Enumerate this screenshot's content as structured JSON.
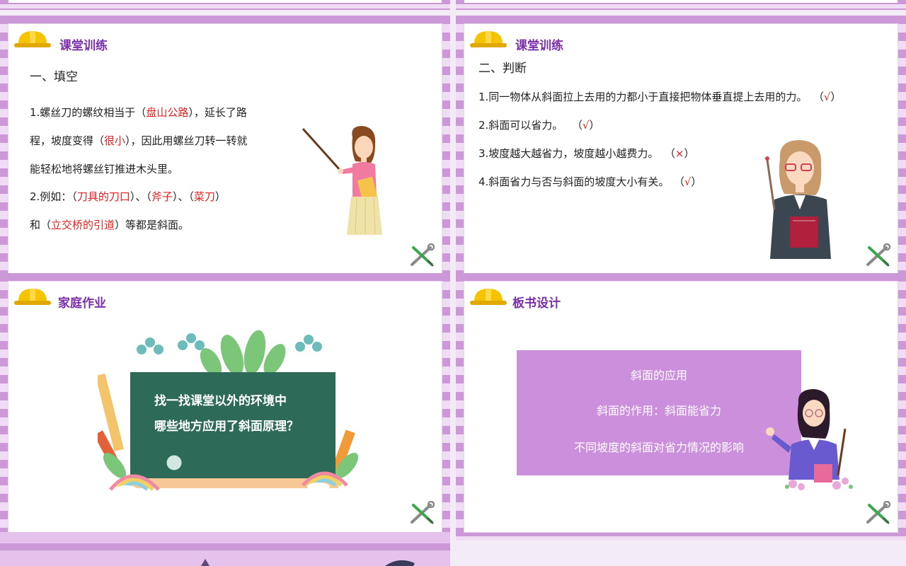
{
  "slides": {
    "s1": {
      "title": "课堂训练",
      "heading": "一、填空",
      "l1a": "1.螺丝刀的螺纹相当于（",
      "l1r": "盘山公路",
      "l1b": "），延长了路",
      "l2a": "程，坡度变得（",
      "l2r": "很小",
      "l2b": "），因此用螺丝刀转一转就",
      "l3": "能轻松地将螺丝钉推进木头里。",
      "l4a": "2.例如：（",
      "l4r1": "刀具的刀口",
      "l4b": "）、（",
      "l4r2": "斧子",
      "l4c": "）、（",
      "l4r3": "菜刀",
      "l4d": "）",
      "l5a": "和（",
      "l5r": "立交桥的引道",
      "l5b": "）等都是斜面。"
    },
    "s2": {
      "title": "课堂训练",
      "heading": "二、判断",
      "items": [
        {
          "text": "1.同一物体从斜面拉上去用的力都小于直接把物体垂直提上去用的力。",
          "open": "（",
          "mark": "√",
          "close": "）"
        },
        {
          "text": "2.斜面可以省力。",
          "open": "（",
          "mark": "√",
          "close": "）"
        },
        {
          "text": "3.坡度越大越省力，坡度越小越费力。",
          "open": "（",
          "mark": "×",
          "close": "）"
        },
        {
          "text": "4.斜面省力与否与斜面的坡度大小有关。",
          "open": "（",
          "mark": "√",
          "close": "）"
        }
      ]
    },
    "s3": {
      "title": "家庭作业",
      "board_line1": "找一找课堂以外的环境中",
      "board_line2": "哪些地方应用了斜面原理？"
    },
    "s4": {
      "title": "板书设计",
      "box_line1": "斜面的应用",
      "box_line2": "斜面的作用：斜面能省力",
      "box_line3": "不同坡度的斜面对省力情况的影响"
    }
  },
  "colors": {
    "accent": "#7b2fa8",
    "answer": "#e02020",
    "stripe_dark": "#cc98d8",
    "stripe_light": "#f0dcf4",
    "board": "#2e6a58",
    "summary_box": "#cc8fdc"
  },
  "icons": [
    "hard-hat-icon",
    "wrench-screwdriver-icon"
  ]
}
